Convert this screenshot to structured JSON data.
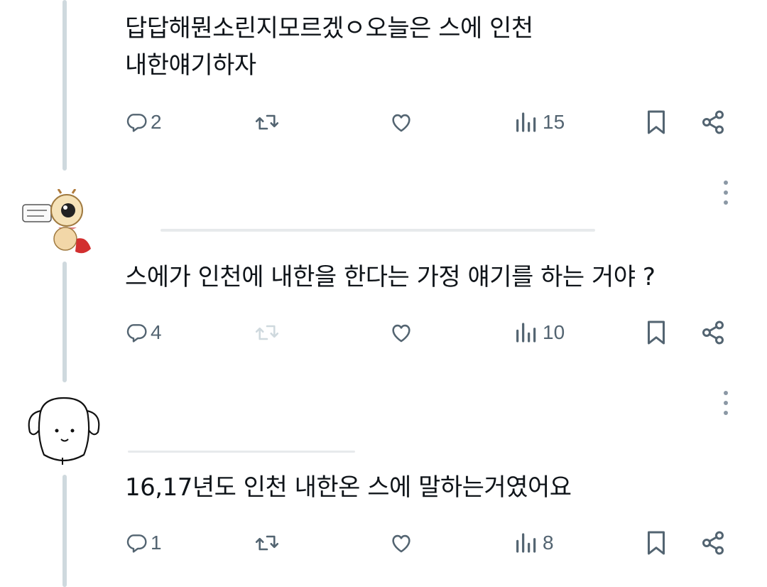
{
  "tweets": [
    {
      "text_line1": "답답해뭔소린지모르겠ㅇ오늘은 스에 인천",
      "text_line2": "내한얘기하자",
      "actions": {
        "replies": "2",
        "views": "15"
      }
    },
    {
      "text": "스에가 인천에 내한을 한다는 가정 얘기를 하는 거야 ?",
      "actions": {
        "replies": "4",
        "views": "10"
      }
    },
    {
      "text": "16,17년도 인천 내한온 스에 말하는거였어요",
      "actions": {
        "replies": "1",
        "views": "8"
      }
    }
  ],
  "icons": {
    "reply": "reply-icon",
    "retweet": "retweet-icon",
    "like": "heart-icon",
    "views": "views-chart-icon",
    "bookmark": "bookmark-icon",
    "share": "share-icon",
    "more": "more-vertical-icon"
  },
  "colors": {
    "text": "#0f1419",
    "icon": "#536471",
    "icon_disabled": "#cfd9de",
    "thread_line": "#cfd9de"
  }
}
